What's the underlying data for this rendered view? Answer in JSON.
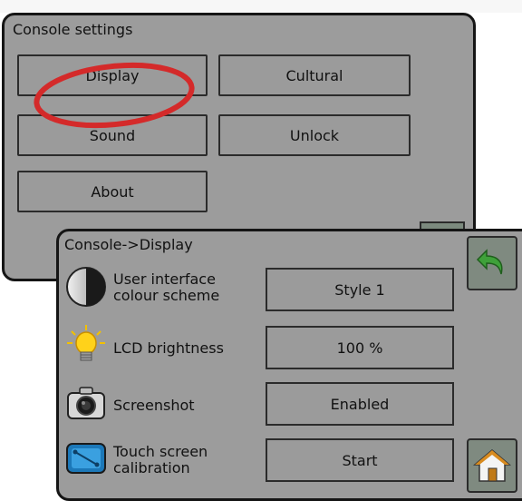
{
  "window": {
    "title": "Console settings",
    "buttons": {
      "display": "Display",
      "cultural": "Cultural",
      "sound": "Sound",
      "unlock": "Unlock",
      "about": "About"
    }
  },
  "dialog": {
    "title": "Console->Display",
    "rows": [
      {
        "label_line1": "User interface",
        "label_line2": "colour scheme",
        "value": "Style 1",
        "icon": "contrast-icon"
      },
      {
        "label_line1": "LCD brightness",
        "label_line2": "",
        "value": "100 %",
        "icon": "lightbulb-icon"
      },
      {
        "label_line1": "Screenshot",
        "label_line2": "",
        "value": "Enabled",
        "icon": "camera-icon"
      },
      {
        "label_line1": "Touch screen",
        "label_line2": "calibration",
        "value": "Start",
        "icon": "touch-calibration-icon"
      }
    ],
    "side_buttons": {
      "back": "back-arrow-icon",
      "home": "home-icon"
    }
  },
  "colors": {
    "panel": "#9c9c9c",
    "border": "#151515",
    "highlight": "#d42a2a",
    "back_arrow": "#3fa13a",
    "home_roof": "#d88b1f"
  }
}
